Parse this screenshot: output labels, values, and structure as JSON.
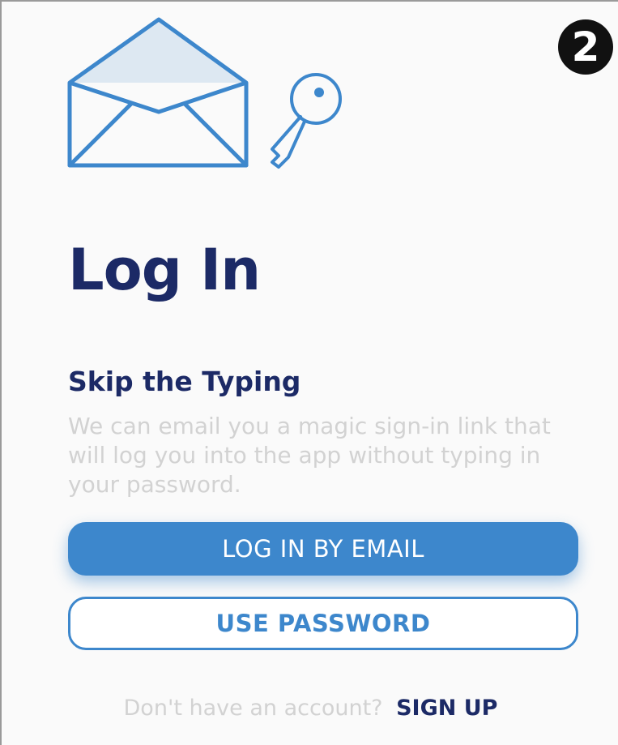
{
  "step_badge": "2",
  "hero": {
    "icons": [
      "envelope-icon",
      "key-icon"
    ]
  },
  "title": "Log In",
  "section": {
    "title": "Skip the Typing",
    "description": "We can email you a magic sign-in link that will log you into the app without typing in your password."
  },
  "buttons": {
    "email_login_label": "LOG IN BY EMAIL",
    "password_label": "USE PASSWORD"
  },
  "signup": {
    "prompt": "Don't have an account?",
    "link_label": "SIGN UP"
  },
  "colors": {
    "primary": "#3d87cc",
    "heading": "#1c2a66",
    "muted_text": "#d2d2d2",
    "background": "#fafafa"
  }
}
